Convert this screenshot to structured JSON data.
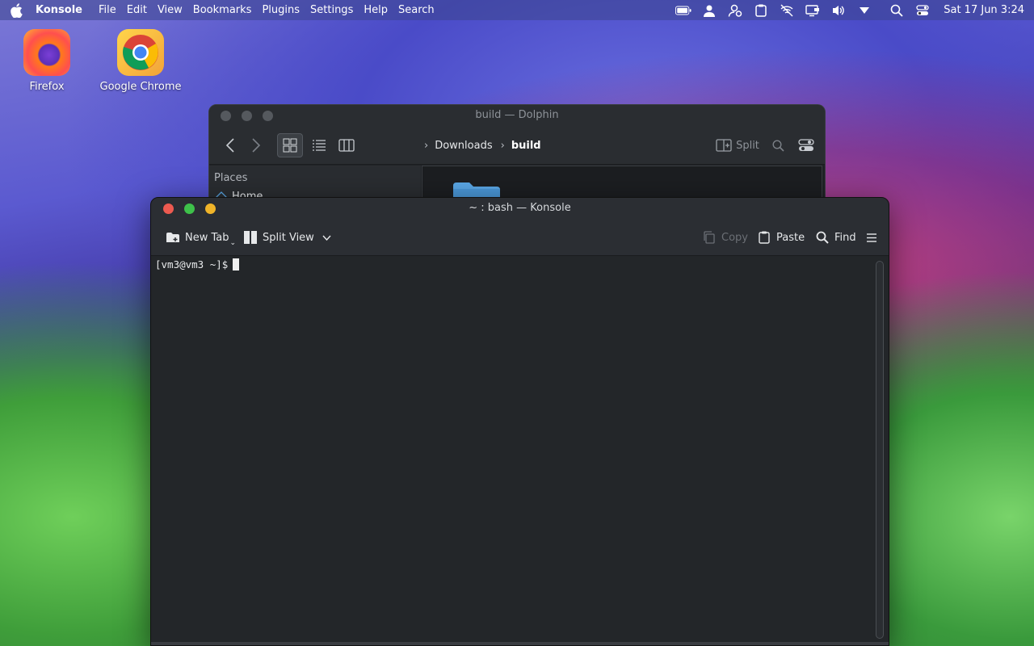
{
  "menubar": {
    "app_name": "Konsole",
    "menus": [
      "File",
      "Edit",
      "View",
      "Bookmarks",
      "Plugins",
      "Settings",
      "Help",
      "Search"
    ],
    "clock": "Sat 17 Jun 3:24"
  },
  "desktop": {
    "icons": [
      {
        "label": "Firefox"
      },
      {
        "label": "Google Chrome"
      }
    ]
  },
  "dolphin": {
    "title": "build — Dolphin",
    "breadcrumb": [
      "Downloads",
      "build"
    ],
    "split_label": "Split",
    "places_header": "Places",
    "places_home": "Home"
  },
  "konsole": {
    "title": "~ : bash — Konsole",
    "toolbar": {
      "new_tab": "New Tab",
      "split_view": "Split View",
      "copy": "Copy",
      "paste": "Paste",
      "find": "Find"
    },
    "prompt": "[vm3@vm3 ~]$"
  },
  "colors": {
    "close": "#ed5a50",
    "minimize": "#f0b429",
    "maximize": "#3ec14a",
    "folder": "#5aa7e6"
  }
}
